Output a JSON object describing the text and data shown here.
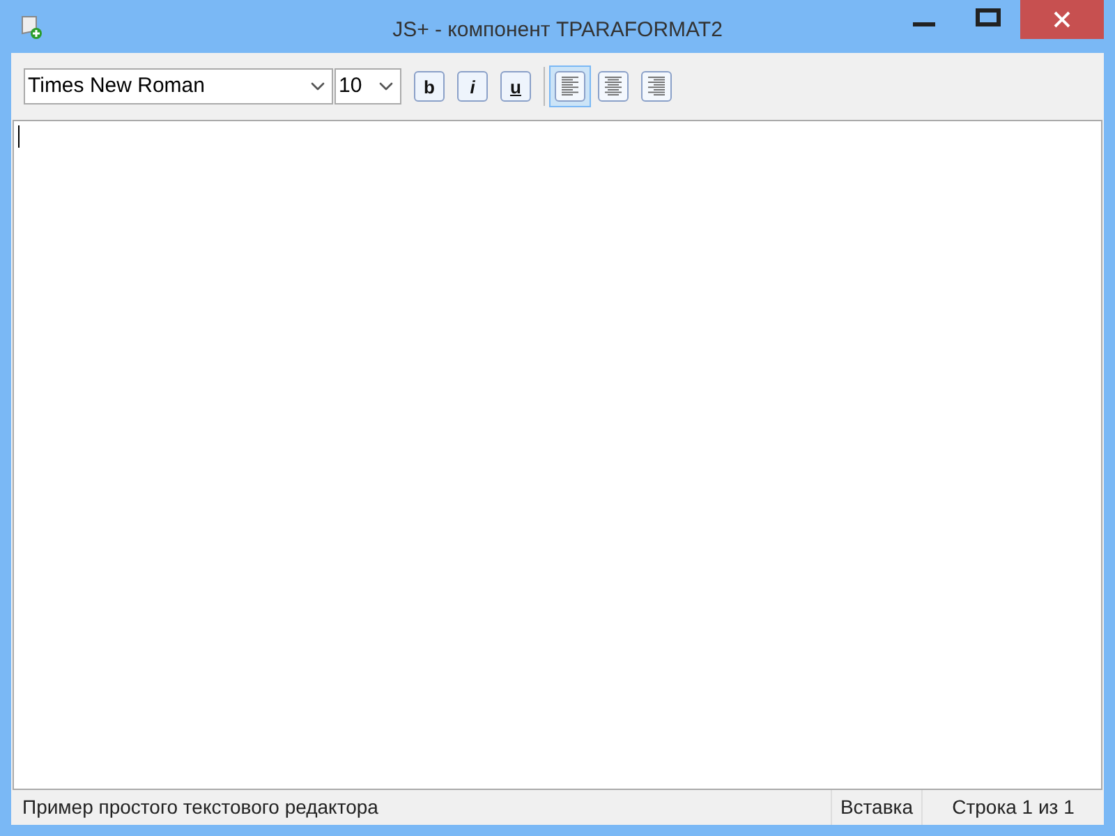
{
  "window": {
    "title": "JS+ - компонент TPARAFORMAT2"
  },
  "toolbar": {
    "font": {
      "value": "Times New Roman"
    },
    "size": {
      "value": "10"
    },
    "styles": [
      {
        "kind": "bold",
        "label": "b",
        "selected": false
      },
      {
        "kind": "italic",
        "label": "i",
        "selected": false
      },
      {
        "kind": "underline",
        "label": "u",
        "selected": false
      }
    ],
    "alignment": [
      {
        "kind": "left",
        "selected": true
      },
      {
        "kind": "center",
        "selected": false
      },
      {
        "kind": "right",
        "selected": false
      }
    ]
  },
  "status_bar": {
    "message": "Пример простого текстового редактора",
    "mode": "Вставка",
    "position": "Строка 1 из 1"
  }
}
